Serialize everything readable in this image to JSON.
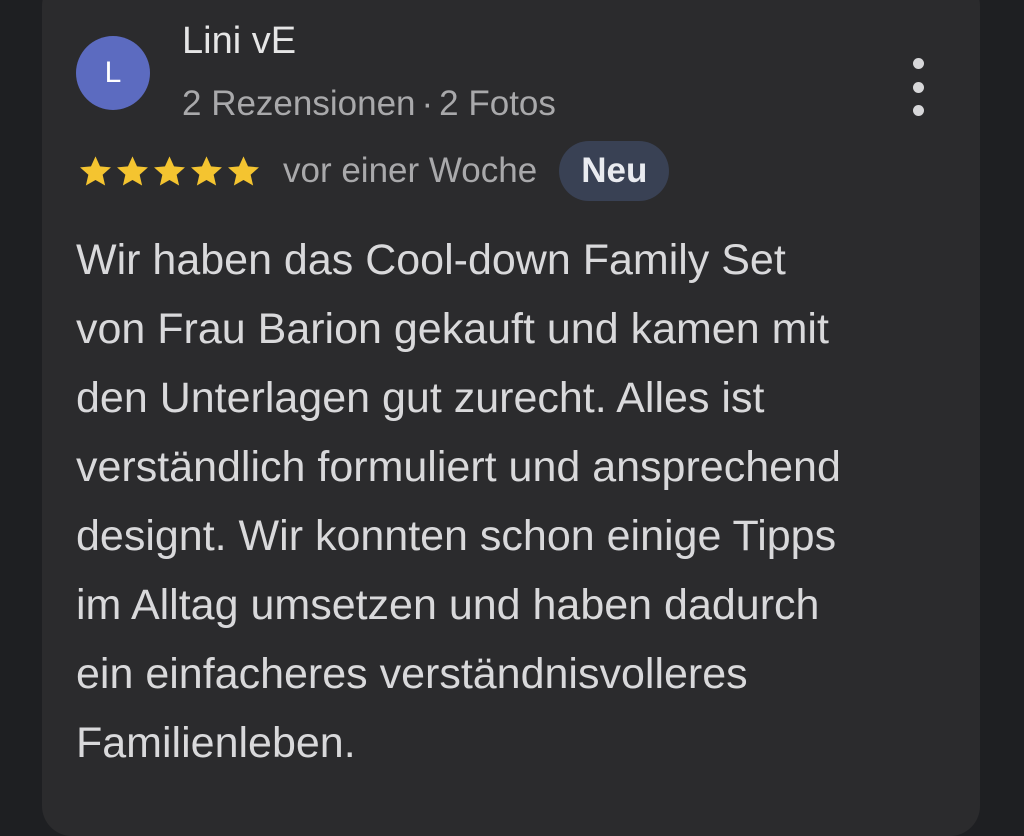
{
  "review": {
    "avatar_letter": "L",
    "author": "Lini vE",
    "reviews_count": "2 Rezensionen",
    "separator": "·",
    "photos_count": "2 Fotos",
    "rating": 5,
    "rating_max": 5,
    "time_ago": "vor einer Woche",
    "badge": "Neu",
    "text_lines": [
      "Wir haben das Cool-down Family Set",
      "von Frau Barion gekauft und kamen mit",
      "den Unterlagen gut zurecht. Alles ist",
      "verständlich formuliert und ansprechend",
      "designt. Wir konnten schon einige Tipps",
      "im Alltag umsetzen und haben dadurch",
      "ein einfacheres verständnisvolleres",
      "Familienleben."
    ]
  },
  "icons": {
    "star": "star-icon",
    "more": "more-vert-icon"
  },
  "colors": {
    "background": "#1e1f22",
    "card": "#2b2b2d",
    "avatar": "#5c6bc0",
    "star": "#f4c430",
    "badge_bg": "#394154",
    "text_primary": "#e6e6e6",
    "text_secondary": "#a9a9ab"
  }
}
